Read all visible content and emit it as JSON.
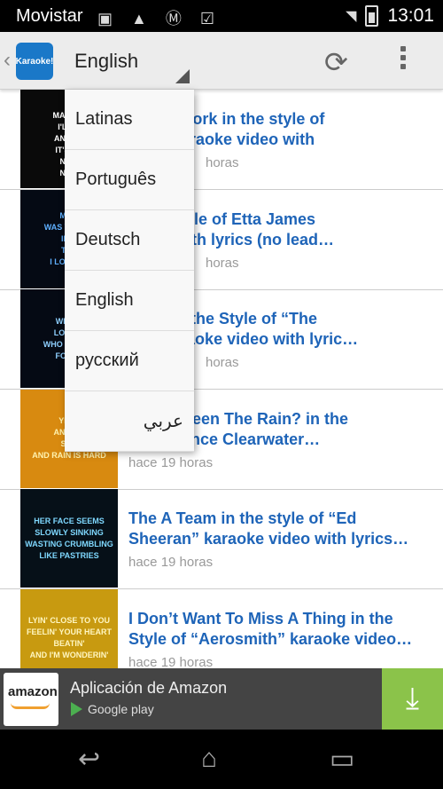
{
  "status_bar": {
    "carrier": "Movistar",
    "time": "13:01",
    "icons": "▣ ▲ Ⓜ ☑"
  },
  "header": {
    "back_icon": "chevron-left-icon",
    "logo_text": "Karaoke!",
    "language_selected": "English",
    "refresh_icon": "refresh-icon",
    "menu_icon": "overflow-menu-icon"
  },
  "dropdown": {
    "options": [
      "Latinas",
      "Português",
      "Deutsch",
      "English",
      "русский",
      "عربي"
    ]
  },
  "videos": [
    {
      "title_line1": "k, New York in the style of",
      "title_line2": "natra karaoke video with",
      "time": "horas",
      "thumb_text": [
        "IF",
        "MAKE IT",
        "I'LL M",
        "ANYWH",
        "IT'S UP",
        "NEW",
        "NEW"
      ],
      "thumb_bg": "#0a0a0a",
      "thumb_fg": "#ffffff"
    },
    {
      "title_line1": "n the style of Etta James",
      "title_line2": "video with lyrics (no lead…",
      "time": "horas",
      "thumb_text": [
        "MY L",
        "WAS WRAPP",
        "IN C",
        "THE",
        "I LOOKED"
      ],
      "thumb_bg": "#050a14",
      "thumb_fg": "#5fb0ff"
    },
    {
      "title_line1": "oung in the Style of “The",
      "title_line2": "rry” karaoke video with lyric…",
      "time": "horas",
      "thumb_text": [
        "WHO S",
        "LOVE M",
        "WHO WOULD",
        "FOREV"
      ],
      "thumb_bg": "#050a14",
      "thumb_fg": "#8fd0ff"
    },
    {
      "title_line1": "u Ever Seen The Rain? in the",
      "title_line2": "“Creedence Clearwater…",
      "time": "hace 19 horas",
      "thumb_text": [
        "YEST",
        "AND DA",
        "SUN",
        "AND RAIN IS HARD"
      ],
      "thumb_bg": "#d88a10",
      "thumb_fg": "#fff3b0"
    },
    {
      "title_line1": "The A Team in the style of “Ed",
      "title_line2": "Sheeran” karaoke video with lyrics…",
      "time": "hace 19 horas",
      "thumb_text": [
        "HER FACE SEEMS",
        "SLOWLY SINKING",
        "WASTING CRUMBLING",
        "LIKE PASTRIES"
      ],
      "thumb_bg": "#061018",
      "thumb_fg": "#7fd8ff"
    },
    {
      "title_line1": "I Don’t Want To Miss A Thing in the",
      "title_line2": "Style of “Aerosmith” karaoke video…",
      "time": "hace 19 horas",
      "thumb_text": [
        "LYIN' CLOSE TO YOU",
        "FEELIN' YOUR HEART",
        "BEATIN'",
        "AND I'M WONDERIN'"
      ],
      "thumb_bg": "#c89a10",
      "thumb_fg": "#fff6c0"
    }
  ],
  "ad": {
    "brand": "amazon",
    "title": "Aplicación de Amazon",
    "store": "Google play",
    "download_icon": "download-icon"
  },
  "navbar": {
    "back": "↩",
    "home": "⌂",
    "recents": "▭"
  }
}
